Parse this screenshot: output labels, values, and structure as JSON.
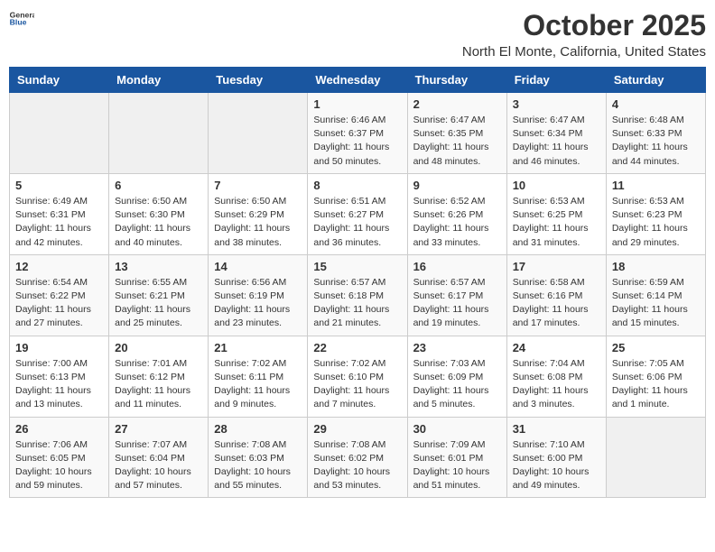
{
  "header": {
    "logo_general": "General",
    "logo_blue": "Blue",
    "month": "October 2025",
    "location": "North El Monte, California, United States"
  },
  "weekdays": [
    "Sunday",
    "Monday",
    "Tuesday",
    "Wednesday",
    "Thursday",
    "Friday",
    "Saturday"
  ],
  "weeks": [
    [
      {
        "day": "",
        "info": ""
      },
      {
        "day": "",
        "info": ""
      },
      {
        "day": "",
        "info": ""
      },
      {
        "day": "1",
        "info": "Sunrise: 6:46 AM\nSunset: 6:37 PM\nDaylight: 11 hours and 50 minutes."
      },
      {
        "day": "2",
        "info": "Sunrise: 6:47 AM\nSunset: 6:35 PM\nDaylight: 11 hours and 48 minutes."
      },
      {
        "day": "3",
        "info": "Sunrise: 6:47 AM\nSunset: 6:34 PM\nDaylight: 11 hours and 46 minutes."
      },
      {
        "day": "4",
        "info": "Sunrise: 6:48 AM\nSunset: 6:33 PM\nDaylight: 11 hours and 44 minutes."
      }
    ],
    [
      {
        "day": "5",
        "info": "Sunrise: 6:49 AM\nSunset: 6:31 PM\nDaylight: 11 hours and 42 minutes."
      },
      {
        "day": "6",
        "info": "Sunrise: 6:50 AM\nSunset: 6:30 PM\nDaylight: 11 hours and 40 minutes."
      },
      {
        "day": "7",
        "info": "Sunrise: 6:50 AM\nSunset: 6:29 PM\nDaylight: 11 hours and 38 minutes."
      },
      {
        "day": "8",
        "info": "Sunrise: 6:51 AM\nSunset: 6:27 PM\nDaylight: 11 hours and 36 minutes."
      },
      {
        "day": "9",
        "info": "Sunrise: 6:52 AM\nSunset: 6:26 PM\nDaylight: 11 hours and 33 minutes."
      },
      {
        "day": "10",
        "info": "Sunrise: 6:53 AM\nSunset: 6:25 PM\nDaylight: 11 hours and 31 minutes."
      },
      {
        "day": "11",
        "info": "Sunrise: 6:53 AM\nSunset: 6:23 PM\nDaylight: 11 hours and 29 minutes."
      }
    ],
    [
      {
        "day": "12",
        "info": "Sunrise: 6:54 AM\nSunset: 6:22 PM\nDaylight: 11 hours and 27 minutes."
      },
      {
        "day": "13",
        "info": "Sunrise: 6:55 AM\nSunset: 6:21 PM\nDaylight: 11 hours and 25 minutes."
      },
      {
        "day": "14",
        "info": "Sunrise: 6:56 AM\nSunset: 6:19 PM\nDaylight: 11 hours and 23 minutes."
      },
      {
        "day": "15",
        "info": "Sunrise: 6:57 AM\nSunset: 6:18 PM\nDaylight: 11 hours and 21 minutes."
      },
      {
        "day": "16",
        "info": "Sunrise: 6:57 AM\nSunset: 6:17 PM\nDaylight: 11 hours and 19 minutes."
      },
      {
        "day": "17",
        "info": "Sunrise: 6:58 AM\nSunset: 6:16 PM\nDaylight: 11 hours and 17 minutes."
      },
      {
        "day": "18",
        "info": "Sunrise: 6:59 AM\nSunset: 6:14 PM\nDaylight: 11 hours and 15 minutes."
      }
    ],
    [
      {
        "day": "19",
        "info": "Sunrise: 7:00 AM\nSunset: 6:13 PM\nDaylight: 11 hours and 13 minutes."
      },
      {
        "day": "20",
        "info": "Sunrise: 7:01 AM\nSunset: 6:12 PM\nDaylight: 11 hours and 11 minutes."
      },
      {
        "day": "21",
        "info": "Sunrise: 7:02 AM\nSunset: 6:11 PM\nDaylight: 11 hours and 9 minutes."
      },
      {
        "day": "22",
        "info": "Sunrise: 7:02 AM\nSunset: 6:10 PM\nDaylight: 11 hours and 7 minutes."
      },
      {
        "day": "23",
        "info": "Sunrise: 7:03 AM\nSunset: 6:09 PM\nDaylight: 11 hours and 5 minutes."
      },
      {
        "day": "24",
        "info": "Sunrise: 7:04 AM\nSunset: 6:08 PM\nDaylight: 11 hours and 3 minutes."
      },
      {
        "day": "25",
        "info": "Sunrise: 7:05 AM\nSunset: 6:06 PM\nDaylight: 11 hours and 1 minute."
      }
    ],
    [
      {
        "day": "26",
        "info": "Sunrise: 7:06 AM\nSunset: 6:05 PM\nDaylight: 10 hours and 59 minutes."
      },
      {
        "day": "27",
        "info": "Sunrise: 7:07 AM\nSunset: 6:04 PM\nDaylight: 10 hours and 57 minutes."
      },
      {
        "day": "28",
        "info": "Sunrise: 7:08 AM\nSunset: 6:03 PM\nDaylight: 10 hours and 55 minutes."
      },
      {
        "day": "29",
        "info": "Sunrise: 7:08 AM\nSunset: 6:02 PM\nDaylight: 10 hours and 53 minutes."
      },
      {
        "day": "30",
        "info": "Sunrise: 7:09 AM\nSunset: 6:01 PM\nDaylight: 10 hours and 51 minutes."
      },
      {
        "day": "31",
        "info": "Sunrise: 7:10 AM\nSunset: 6:00 PM\nDaylight: 10 hours and 49 minutes."
      },
      {
        "day": "",
        "info": ""
      }
    ]
  ]
}
